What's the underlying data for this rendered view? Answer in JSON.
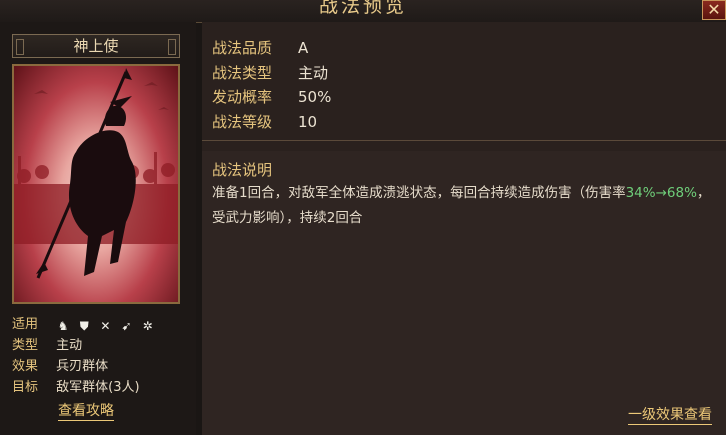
{
  "window": {
    "title": "战法预览",
    "close_label": "✕"
  },
  "card": {
    "name": "神上使",
    "props": [
      {
        "label": "适用",
        "type": "icons",
        "icons": [
          "cavalry-icon",
          "shield-icon",
          "archer-icon",
          "spear-icon",
          "siege-icon"
        ]
      },
      {
        "label": "类型",
        "value": "主动"
      },
      {
        "label": "效果",
        "value": "兵刃群体"
      },
      {
        "label": "目标",
        "value": "敌军群体(3人)"
      }
    ],
    "guide_link": "查看攻略"
  },
  "stats": [
    {
      "label": "战法品质",
      "value": "A"
    },
    {
      "label": "战法类型",
      "value": "主动"
    },
    {
      "label": "发动概率",
      "value": "50%"
    },
    {
      "label": "战法等级",
      "value": "10"
    }
  ],
  "description": {
    "title": "战法说明",
    "text_before": "准备1回合，对敌军全体造成溃逃状态，每回合持续造成伤害（伤害率",
    "highlight": "34%→68%",
    "text_after": "，受武力影响），持续2回合"
  },
  "effect_link": "一级效果查看",
  "colors": {
    "label_gold": "#e5c47e",
    "highlight_green": "#6fce7a",
    "link_gold": "#ecc878"
  }
}
